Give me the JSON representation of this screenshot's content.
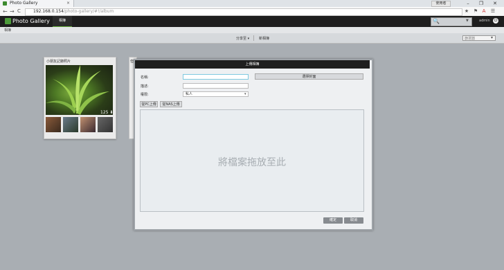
{
  "browser": {
    "tab_title": "Photo Gallery",
    "tab_close": "×",
    "window_user": "使用者",
    "window_buttons": [
      "–",
      "❐",
      "✕"
    ],
    "nav": [
      "←",
      "→",
      "C"
    ],
    "url_host": "192.168.0.154",
    "url_path": "/photo-gallery/#!/album",
    "extension_icons": [
      "★",
      "⚑",
      "A",
      "☰"
    ]
  },
  "app": {
    "title": "Photo Gallery",
    "nav_album": "相簿",
    "search_icon": "🔍",
    "search_caret": "▼",
    "user_label": "admin",
    "user_icon": "⏻"
  },
  "subbar": {
    "breadcrumb": "相簿"
  },
  "toolbar": {
    "share_label": "分享至 ▾",
    "new_label": "新相簿",
    "filter_placeholder": "篩選器",
    "filter_icon": "▾"
  },
  "album": {
    "name": "小朋友記錄照片",
    "count": "125",
    "count_icon": "⬇"
  },
  "album2": {
    "name": "但"
  },
  "modal": {
    "title": "上傳相簿",
    "name_label": "名稱:",
    "description_label": "描述:",
    "permission_label": "權限:",
    "permission_value": "私人",
    "select_caret": "▾",
    "cover_button": "選擇封面",
    "upload_pc_button": "從PC上傳",
    "upload_nas_button": "從NAS上傳",
    "drop_text": "將檔案拖放至此",
    "confirm_button": "確定",
    "cancel_button": "取消"
  },
  "colors": {
    "app_bar": "#1e1e1e",
    "accent": "#6ab23f",
    "modal_header": "#1f1f1f",
    "footer_button": "#878b90"
  }
}
